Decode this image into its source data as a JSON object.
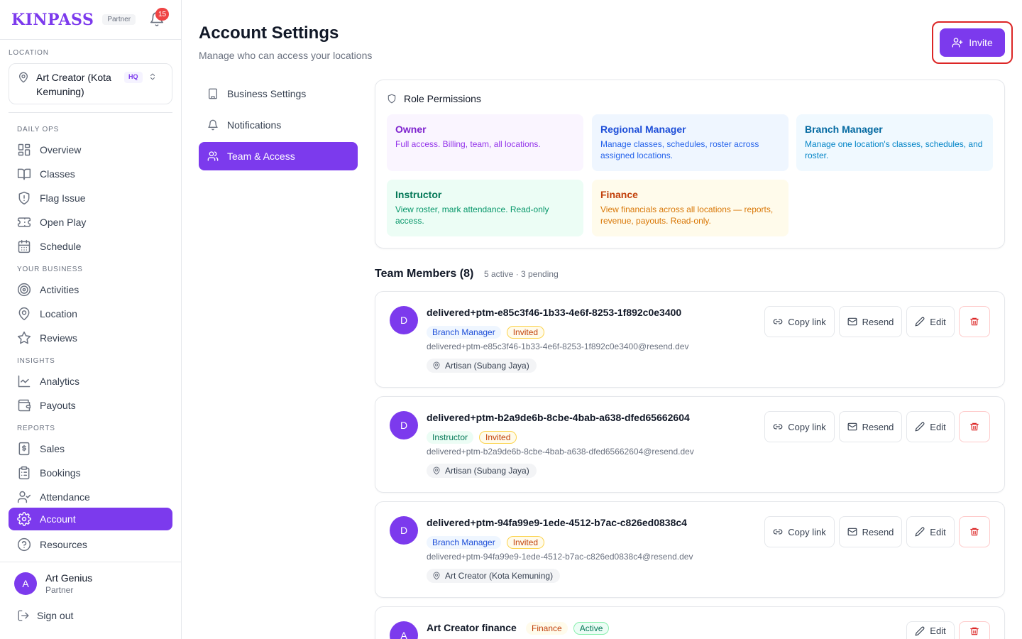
{
  "app": {
    "logo": "KINPASS",
    "partner_tag": "Partner",
    "notification_count": "15"
  },
  "sidebar": {
    "location_label": "LOCATION",
    "location_name": "Art Creator (Kota Kemuning)",
    "location_badge": "HQ",
    "sections": {
      "daily_ops": "DAILY OPS",
      "your_business": "YOUR BUSINESS",
      "insights": "INSIGHTS",
      "reports": "REPORTS"
    },
    "items": {
      "overview": "Overview",
      "classes": "Classes",
      "flag_issue": "Flag Issue",
      "open_play": "Open Play",
      "schedule": "Schedule",
      "activities": "Activities",
      "location": "Location",
      "reviews": "Reviews",
      "analytics": "Analytics",
      "payouts": "Payouts",
      "sales": "Sales",
      "bookings": "Bookings",
      "attendance": "Attendance",
      "account": "Account",
      "resources": "Resources"
    },
    "user": {
      "initial": "A",
      "name": "Art Genius",
      "role": "Partner"
    },
    "sign_out": "Sign out"
  },
  "header": {
    "title": "Account Settings",
    "subtitle": "Manage who can access your locations",
    "invite_label": "Invite"
  },
  "settings_nav": {
    "business": "Business Settings",
    "notifications": "Notifications",
    "team": "Team & Access"
  },
  "roles": {
    "heading": "Role Permissions",
    "owner": {
      "name": "Owner",
      "desc": "Full access. Billing, team, all locations."
    },
    "regional": {
      "name": "Regional Manager",
      "desc": "Manage classes, schedules, roster across assigned locations."
    },
    "branch": {
      "name": "Branch Manager",
      "desc": "Manage one location's classes, schedules, and roster."
    },
    "instructor": {
      "name": "Instructor",
      "desc": "View roster, mark attendance. Read-only access."
    },
    "finance": {
      "name": "Finance",
      "desc": "View financials across all locations — reports, revenue, payouts. Read-only."
    }
  },
  "team": {
    "title": "Team Members (8)",
    "meta": "5 active · 3 pending",
    "actions": {
      "copy_link": "Copy link",
      "resend": "Resend",
      "edit": "Edit"
    },
    "members": [
      {
        "initial": "D",
        "name": "delivered+ptm-e85c3f46-1b33-4e6f-8253-1f892c0e3400",
        "role": "Branch Manager",
        "status": "Invited",
        "email": "delivered+ptm-e85c3f46-1b33-4e6f-8253-1f892c0e3400@resend.dev",
        "location": "Artisan (Subang Jaya)"
      },
      {
        "initial": "D",
        "name": "delivered+ptm-b2a9de6b-8cbe-4bab-a638-dfed65662604",
        "role": "Instructor",
        "status": "Invited",
        "email": "delivered+ptm-b2a9de6b-8cbe-4bab-a638-dfed65662604@resend.dev",
        "location": "Artisan (Subang Jaya)"
      },
      {
        "initial": "D",
        "name": "delivered+ptm-94fa99e9-1ede-4512-b7ac-c826ed0838c4",
        "role": "Branch Manager",
        "status": "Invited",
        "email": "delivered+ptm-94fa99e9-1ede-4512-b7ac-c826ed0838c4@resend.dev",
        "location": "Art Creator (Kota Kemuning)"
      },
      {
        "initial": "A",
        "name": "Art Creator finance",
        "role": "Finance",
        "status": "Active"
      }
    ]
  },
  "colors": {
    "accent": "#7c3aed",
    "danger": "#dc2626"
  }
}
